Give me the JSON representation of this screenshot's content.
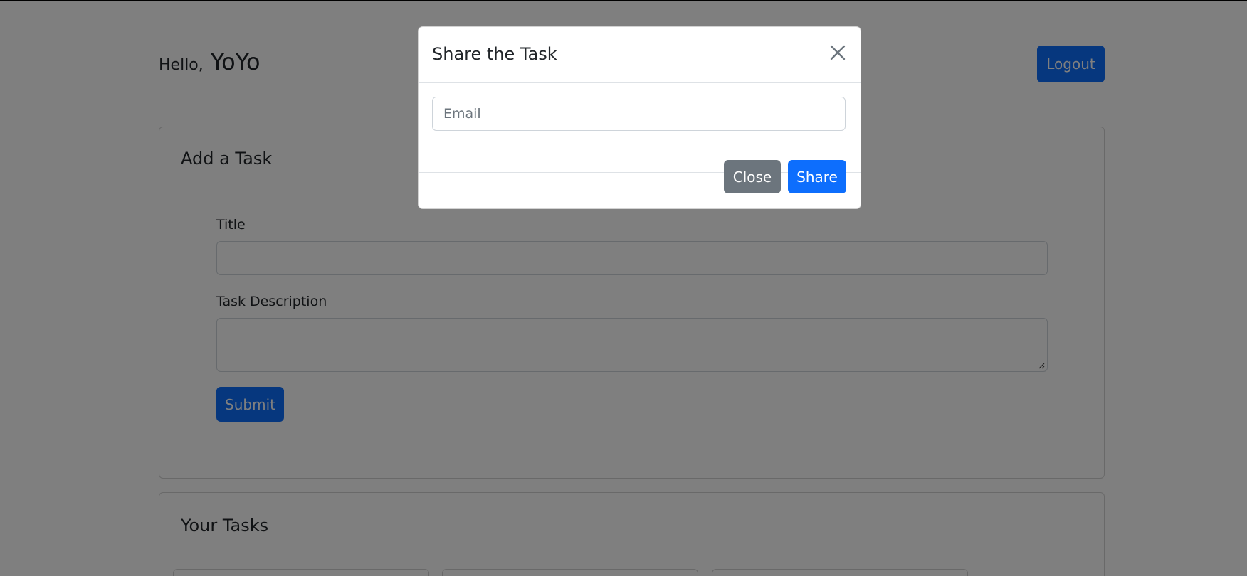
{
  "header": {
    "hello_label": "Hello,",
    "username": "YoYo",
    "logout_label": "Logout"
  },
  "add_task": {
    "card_title": "Add a Task",
    "title_label": "Title",
    "title_value": "",
    "description_label": "Task Description",
    "description_value": "",
    "submit_label": "Submit"
  },
  "your_tasks": {
    "card_title": "Your Tasks"
  },
  "share_modal": {
    "title": "Share the Task",
    "email_placeholder": "Email",
    "email_value": "",
    "close_label": "Close",
    "share_label": "Share"
  },
  "colors": {
    "primary": "#0d6efd",
    "secondary": "#6c757d",
    "backdrop": "rgba(0,0,0,0.5)"
  }
}
